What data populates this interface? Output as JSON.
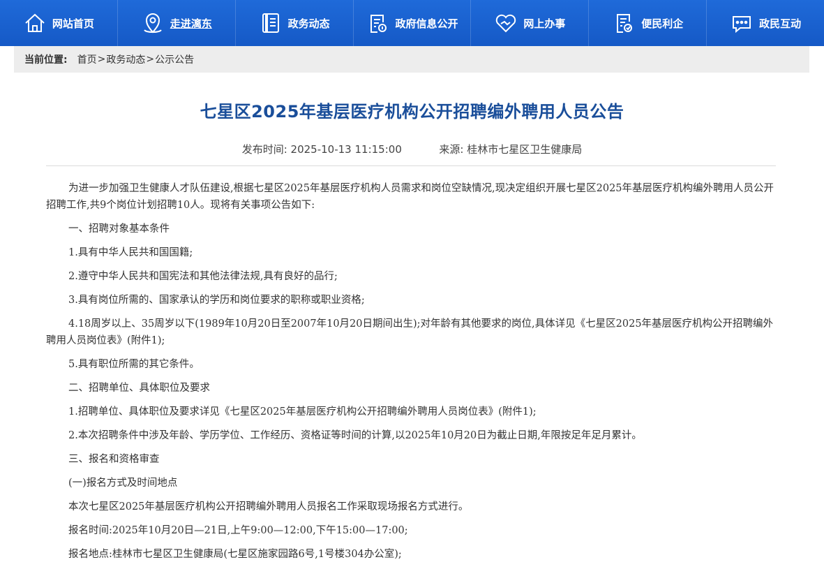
{
  "nav": [
    {
      "label": "网站首页",
      "icon": "home-icon"
    },
    {
      "label": "走进漓东",
      "icon": "location-pin-icon"
    },
    {
      "label": "政务动态",
      "icon": "document-icon"
    },
    {
      "label": "政府信息公开",
      "icon": "info-document-icon"
    },
    {
      "label": "网上办事",
      "icon": "handshake-heart-icon"
    },
    {
      "label": "便民利企",
      "icon": "service-document-icon"
    },
    {
      "label": "政民互动",
      "icon": "chat-bubble-icon"
    }
  ],
  "breadcrumb": {
    "prefix": "当前位置:",
    "items": [
      "首页",
      "政务动态",
      "公示公告"
    ],
    "separator": ">"
  },
  "article": {
    "title": "七星区2025年基层医疗机构公开招聘编外聘用人员公告",
    "publish_label": "发布时间:",
    "publish_time": "2025-10-13 11:15:00",
    "source_label": "来源:",
    "source": "桂林市七星区卫生健康局",
    "paragraphs": [
      "为进一步加强卫生健康人才队伍建设,根据七星区2025年基层医疗机构人员需求和岗位空缺情况,现决定组织开展七星区2025年基层医疗机构编外聘用人员公开招聘工作,共9个岗位计划招聘10人。现将有关事项公告如下:",
      "一、招聘对象基本条件",
      "1.具有中华人民共和国国籍;",
      "2.遵守中华人民共和国宪法和其他法律法规,具有良好的品行;",
      "3.具有岗位所需的、国家承认的学历和岗位要求的职称或职业资格;",
      "4.18周岁以上、35周岁以下(1989年10月20日至2007年10月20日期间出生);对年龄有其他要求的岗位,具体详见《七星区2025年基层医疗机构公开招聘编外聘用人员岗位表》(附件1);",
      "5.具有职位所需的其它条件。",
      "二、招聘单位、具体职位及要求",
      "1.招聘单位、具体职位及要求详见《七星区2025年基层医疗机构公开招聘编外聘用人员岗位表》(附件1);",
      "2.本次招聘条件中涉及年龄、学历学位、工作经历、资格证等时间的计算,以2025年10月20日为截止日期,年限按足年足月累计。",
      "三、报名和资格审查",
      "(一)报名方式及时间地点",
      "本次七星区2025年基层医疗机构公开招聘编外聘用人员报名工作采取现场报名方式进行。",
      "报名时间:2025年10月20日—21日,上午9:00—12:00,下午15:00—17:00;",
      "报名地点:桂林市七星区卫生健康局(七星区施家园路6号,1号楼304办公室);"
    ]
  }
}
